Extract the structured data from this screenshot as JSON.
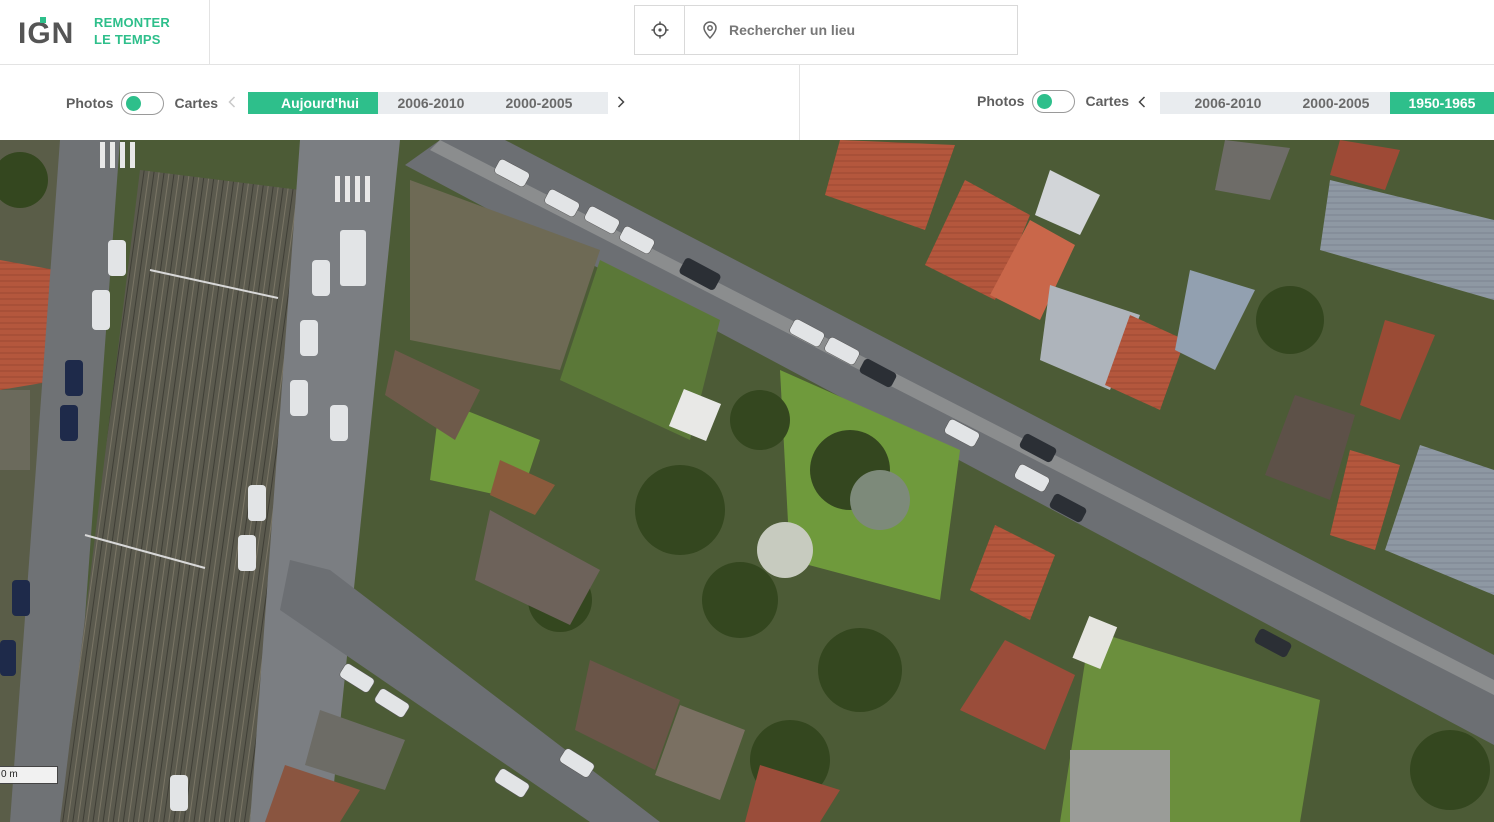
{
  "brand": {
    "logo_text": "IGN",
    "line1": "REMONTER",
    "line2": "LE TEMPS",
    "accent_color": "#2ebf8b"
  },
  "search": {
    "placeholder": "Rechercher un lieu",
    "locate_icon": "crosshair-icon",
    "pin_icon": "map-pin-icon"
  },
  "left_panel": {
    "photos_label": "Photos",
    "cartes_label": "Cartes",
    "periods": [
      {
        "label": "Aujourd'hui",
        "active": true
      },
      {
        "label": "2006-2010",
        "active": false
      },
      {
        "label": "2000-2005",
        "active": false
      }
    ]
  },
  "right_panel": {
    "photos_label": "Photos",
    "cartes_label": "Cartes",
    "periods": [
      {
        "label": "2006-2010",
        "active": false
      },
      {
        "label": "2000-2005",
        "active": false
      },
      {
        "label": "1950-1965",
        "active": true
      }
    ]
  },
  "map": {
    "scale_label": "0 m"
  }
}
